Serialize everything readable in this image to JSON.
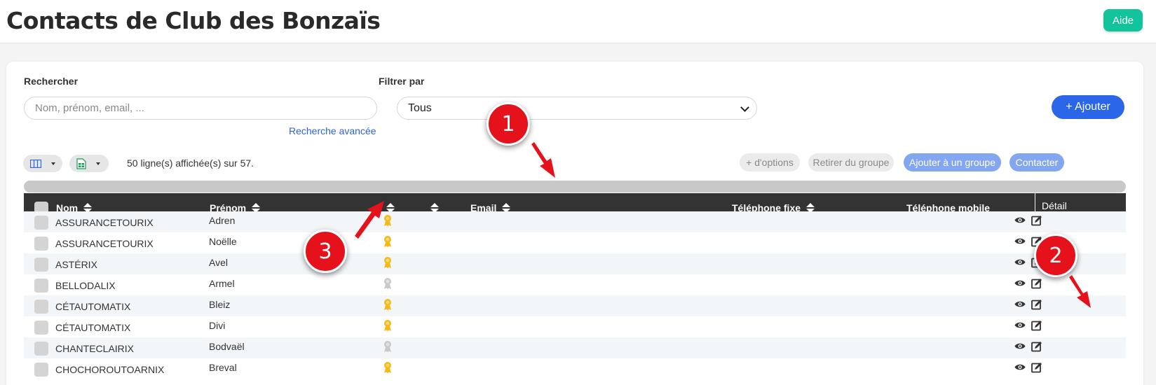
{
  "header": {
    "title": "Contacts de Club des Bonzaïs",
    "help_label": "Aide"
  },
  "search": {
    "label": "Rechercher",
    "placeholder": "Nom, prénom, email, ...",
    "value": "",
    "advanced_link": "Recherche avancée"
  },
  "filter": {
    "label": "Filtrer par",
    "selected": "Tous"
  },
  "add_button": "+ Ajouter",
  "toolbar": {
    "rows_info": "50 ligne(s) affichée(s) sur 57.",
    "more_options": "+ d'options",
    "remove_group": "Retirer du groupe",
    "add_group": "Ajouter à un groupe",
    "contact": "Contacter"
  },
  "table": {
    "columns": {
      "nom": "Nom",
      "prenom": "Prénom",
      "email": "Email",
      "tel_fixe": "Téléphone fixe",
      "tel_mobile": "Téléphone mobile",
      "detail": "Détail"
    },
    "rows": [
      {
        "nom": "ASSURANCETOURIX",
        "prenom": "Adren",
        "medal": "gold"
      },
      {
        "nom": "ASSURANCETOURIX",
        "prenom": "Noëlle",
        "medal": "gold"
      },
      {
        "nom": "ASTÉRIX",
        "prenom": "Avel",
        "medal": "gold"
      },
      {
        "nom": "BELLODALIX",
        "prenom": "Armel",
        "medal": "silver"
      },
      {
        "nom": "CÉTAUTOMATIX",
        "prenom": "Bleiz",
        "medal": "gold"
      },
      {
        "nom": "CÉTAUTOMATIX",
        "prenom": "Divi",
        "medal": "gold"
      },
      {
        "nom": "CHANTECLAIRIX",
        "prenom": "Bodvaël",
        "medal": "silver"
      },
      {
        "nom": "CHOCHOROUTOARNIX",
        "prenom": "Breval",
        "medal": "gold"
      }
    ]
  },
  "callouts": [
    "1",
    "2",
    "3"
  ],
  "colors": {
    "accent": "#2b66e8",
    "help": "#13c39b",
    "callout": "#e5121b",
    "header_bg": "#333333",
    "gold": "#f5b915",
    "silver": "#c8c8c8"
  },
  "icons": {
    "columns": "columns-icon",
    "export": "spreadsheet-export-icon",
    "view": "eye-icon",
    "edit": "edit-icon",
    "medal": "medal-icon"
  }
}
